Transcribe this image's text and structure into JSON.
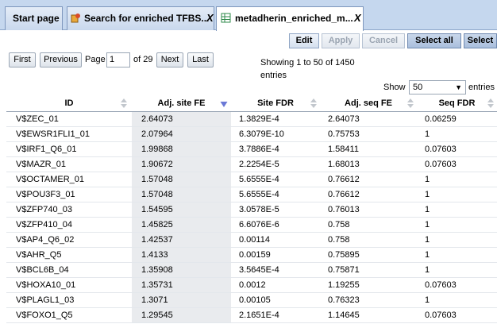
{
  "tabs": [
    {
      "label": "Start page"
    },
    {
      "label": "Search for enriched TFBS...",
      "close": "X"
    },
    {
      "label": "metadherin_enriched_m...",
      "close": "X"
    }
  ],
  "toolbar": {
    "edit": "Edit",
    "apply": "Apply",
    "cancel": "Cancel",
    "select_all": "Select all",
    "select": "Select"
  },
  "pager": {
    "first": "First",
    "previous": "Previous",
    "page_label": "Page",
    "page_value": "1",
    "of_label": "of 29",
    "next": "Next",
    "last": "Last",
    "showing": "Showing 1 to 50 of 1450 entries",
    "show_label": "Show",
    "show_value": "50",
    "entries_label": "entries"
  },
  "table": {
    "columns": [
      "ID",
      "Adj. site FE",
      "Site FDR",
      "Adj. seq FE",
      "Seq FDR"
    ],
    "sorted_column": "Adj. site FE",
    "rows": [
      [
        "V$ZEC_01",
        "2.64073",
        "1.3829E-4",
        "2.64073",
        "0.06259"
      ],
      [
        "V$EWSR1FLI1_01",
        "2.07964",
        "6.3079E-10",
        "0.75753",
        "1"
      ],
      [
        "V$IRF1_Q6_01",
        "1.99868",
        "3.7886E-4",
        "1.58411",
        "0.07603"
      ],
      [
        "V$MAZR_01",
        "1.90672",
        "2.2254E-5",
        "1.68013",
        "0.07603"
      ],
      [
        "V$OCTAMER_01",
        "1.57048",
        "5.6555E-4",
        "0.76612",
        "1"
      ],
      [
        "V$POU3F3_01",
        "1.57048",
        "5.6555E-4",
        "0.76612",
        "1"
      ],
      [
        "V$ZFP740_03",
        "1.54595",
        "3.0578E-5",
        "0.76013",
        "1"
      ],
      [
        "V$ZFP410_04",
        "1.45825",
        "6.6076E-6",
        "0.758",
        "1"
      ],
      [
        "V$AP4_Q6_02",
        "1.42537",
        "0.00114",
        "0.758",
        "1"
      ],
      [
        "V$AHR_Q5",
        "1.4133",
        "0.00159",
        "0.75895",
        "1"
      ],
      [
        "V$BCL6B_04",
        "1.35908",
        "3.5645E-4",
        "0.75871",
        "1"
      ],
      [
        "V$HOXA10_01",
        "1.35731",
        "0.0012",
        "1.19255",
        "0.07603"
      ],
      [
        "V$PLAGL1_03",
        "1.3071",
        "0.00105",
        "0.76323",
        "1"
      ],
      [
        "V$FOXO1_Q5",
        "1.29545",
        "2.1651E-4",
        "1.14645",
        "0.07603"
      ]
    ]
  }
}
